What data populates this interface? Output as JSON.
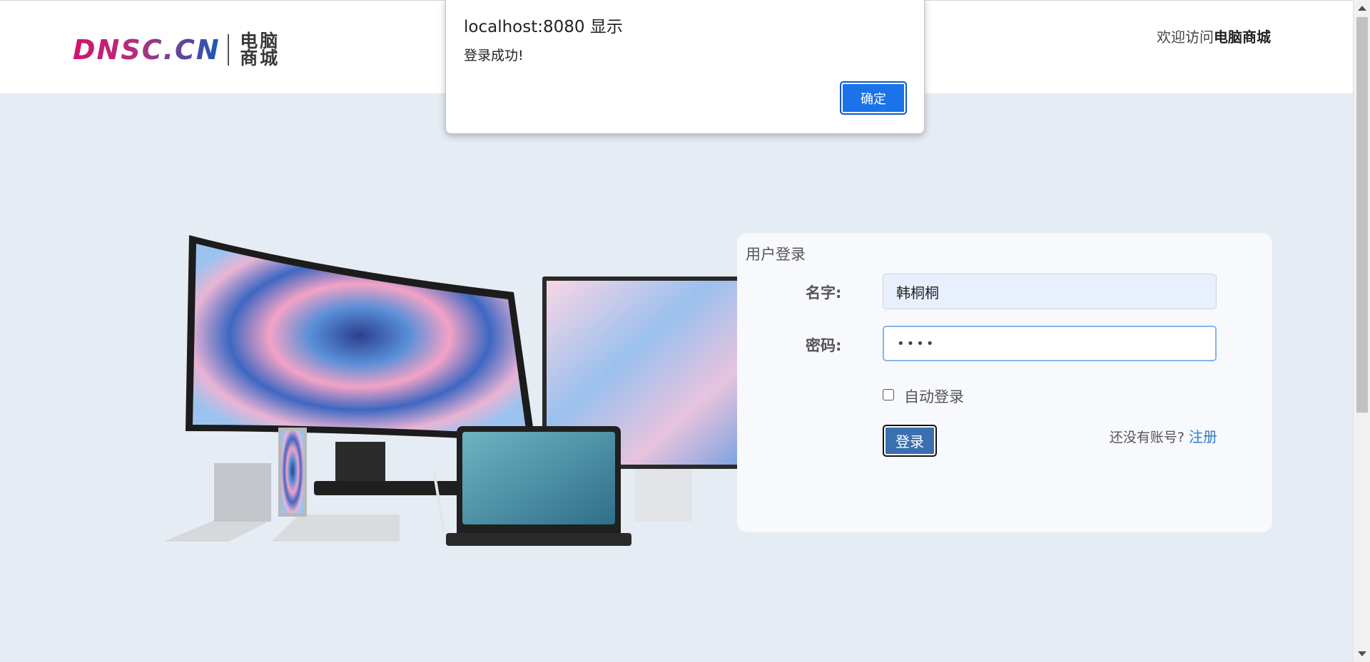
{
  "header": {
    "logo_text": "DNSC.CN",
    "logo_cn_chars": [
      "电",
      "脑",
      "商",
      "城"
    ],
    "welcome_prefix": "欢迎访问",
    "welcome_site": "电脑商城"
  },
  "hero": {
    "image": "computer-devices-image"
  },
  "login": {
    "title": "用户登录",
    "name_label": "名字:",
    "name_value": "韩桐桐",
    "password_label": "密码:",
    "password_value": "••••",
    "auto_login_label": "自动登录",
    "auto_login_checked": false,
    "submit_label": "登录",
    "no_account_text": "还没有账号?",
    "register_label": "注册"
  },
  "dialog": {
    "title": "localhost:8080 显示",
    "message": "登录成功!",
    "ok_label": "确定"
  },
  "colors": {
    "page_bg": "#e6ecf4",
    "header_bg": "#ffffff",
    "panel_bg": "#f7f9fc",
    "login_button": "#3a6fb0",
    "dialog_button": "#1a73e8",
    "link": "#2f7bc7",
    "logo_pink": "#d2126d",
    "logo_blue": "#1a58b8"
  }
}
